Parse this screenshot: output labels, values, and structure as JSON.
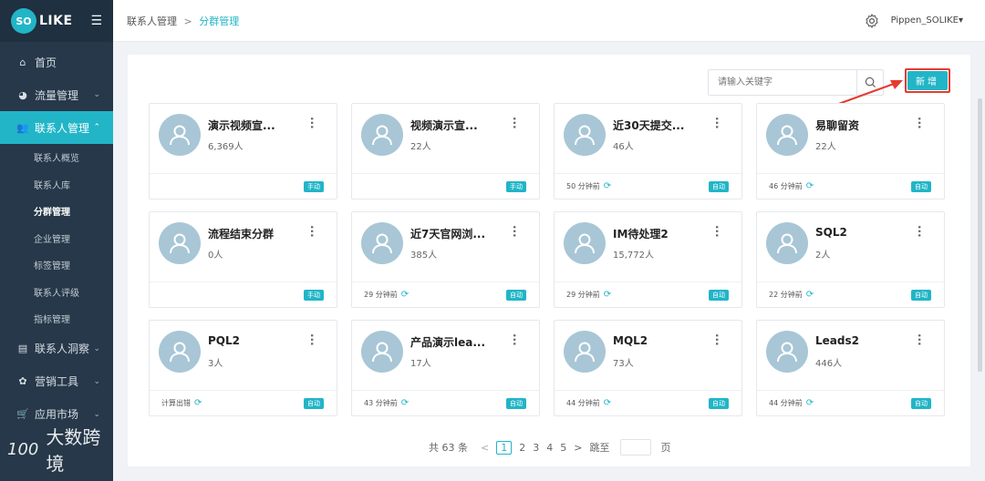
{
  "logo": {
    "badge": "SO",
    "text": "LIKE"
  },
  "sidebar": {
    "items": [
      {
        "label": "首页",
        "icon": "home-icon"
      },
      {
        "label": "流量管理",
        "icon": "pie-icon"
      },
      {
        "label": "联系人管理",
        "icon": "users-icon"
      },
      {
        "label": "联系人洞察",
        "icon": "id-card-icon"
      },
      {
        "label": "营销工具",
        "icon": "gears-icon"
      },
      {
        "label": "应用市场",
        "icon": "cart-icon"
      }
    ],
    "subitems": [
      "联系人概览",
      "联系人库",
      "分群管理",
      "企业管理",
      "标签管理",
      "联系人评级",
      "指标管理"
    ]
  },
  "watermark": {
    "text": "大数跨境",
    "mark": "100"
  },
  "header": {
    "breadcrumb_parent": "联系人管理",
    "breadcrumb_sep": ">",
    "breadcrumb_current": "分群管理",
    "user": "Pippen_SOLIKE▾"
  },
  "search": {
    "placeholder": "请输入关键字"
  },
  "new_button": "新增",
  "cards": [
    {
      "title": "演示视频宣...",
      "count": "6,369人",
      "footer": "",
      "tag": "手动"
    },
    {
      "title": "视频演示宣...",
      "count": "22人",
      "footer": "",
      "tag": "手动"
    },
    {
      "title": "近30天提交...",
      "count": "46人",
      "footer": "50 分钟前",
      "tag": "自动"
    },
    {
      "title": "易聊留资",
      "count": "22人",
      "footer": "46 分钟前",
      "tag": "自动"
    },
    {
      "title": "流程结束分群",
      "count": "0人",
      "footer": "",
      "tag": "手动"
    },
    {
      "title": "近7天官网浏...",
      "count": "385人",
      "footer": "29 分钟前",
      "tag": "自动"
    },
    {
      "title": "IM待处理2",
      "count": "15,772人",
      "footer": "29 分钟前",
      "tag": "自动"
    },
    {
      "title": "SQL2",
      "count": "2人",
      "footer": "22 分钟前",
      "tag": "自动"
    },
    {
      "title": "PQL2",
      "count": "3人",
      "footer": "计算出错",
      "tag": "自动"
    },
    {
      "title": "产品演示lea...",
      "count": "17人",
      "footer": "43 分钟前",
      "tag": "自动"
    },
    {
      "title": "MQL2",
      "count": "73人",
      "footer": "44 分钟前",
      "tag": "自动"
    },
    {
      "title": "Leads2",
      "count": "446人",
      "footer": "44 分钟前",
      "tag": "自动"
    }
  ],
  "pagination": {
    "total": "共 63 条",
    "prev": "<",
    "pages": [
      "1",
      "2",
      "3",
      "4",
      "5"
    ],
    "next": ">",
    "jump_label": "跳至",
    "page_suffix": "页"
  },
  "colors": {
    "accent": "#21b5c7",
    "sidebar": "#263849",
    "highlight": "#e53b2e"
  }
}
